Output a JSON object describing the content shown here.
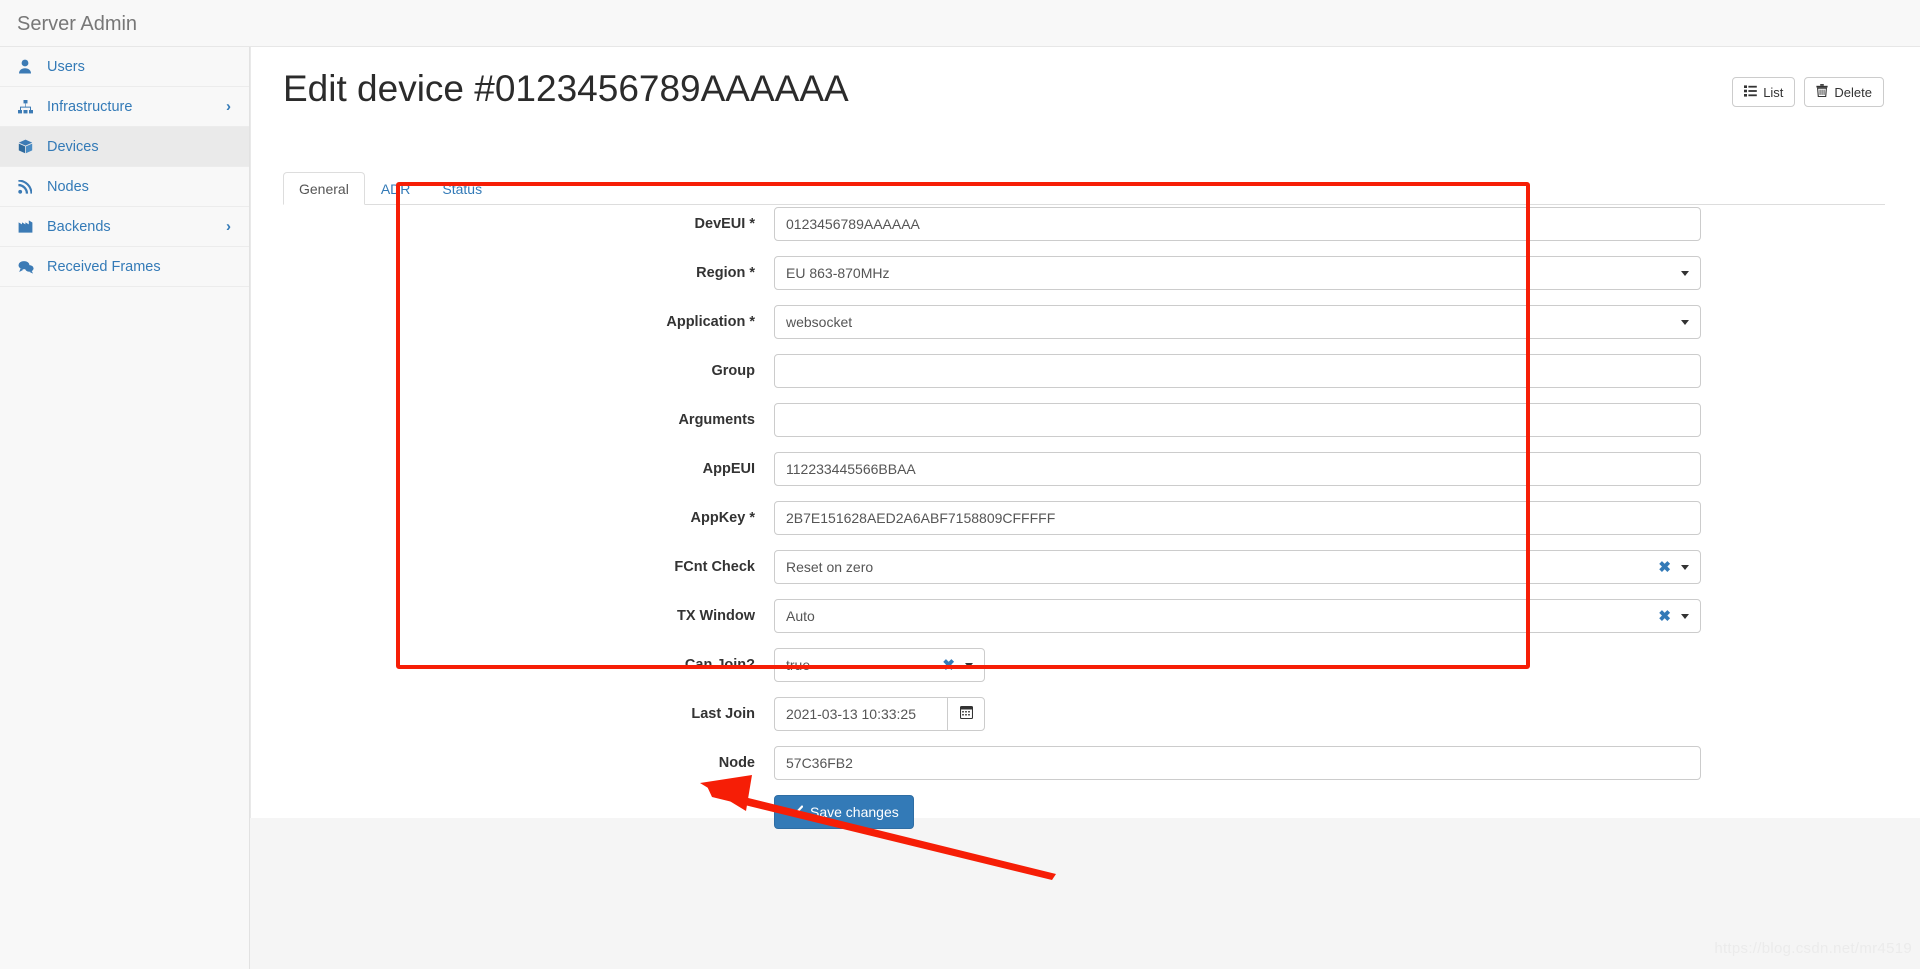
{
  "app": {
    "brand": "Server Admin"
  },
  "sidebar": {
    "items": [
      {
        "label": "Users",
        "icon": "user-icon",
        "has_caret": false,
        "active": false
      },
      {
        "label": "Infrastructure",
        "icon": "sitemap-icon",
        "has_caret": true,
        "active": false
      },
      {
        "label": "Devices",
        "icon": "cube-icon",
        "has_caret": false,
        "active": true
      },
      {
        "label": "Nodes",
        "icon": "rss-icon",
        "has_caret": false,
        "active": false
      },
      {
        "label": "Backends",
        "icon": "bar-chart-icon",
        "has_caret": true,
        "active": false
      },
      {
        "label": "Received Frames",
        "icon": "comments-icon",
        "has_caret": false,
        "active": false
      }
    ],
    "caret_glyph": "›"
  },
  "header": {
    "title": "Edit device #0123456789AAAAAA",
    "actions": [
      {
        "label": "List",
        "icon": "list-icon"
      },
      {
        "label": "Delete",
        "icon": "trash-icon"
      }
    ]
  },
  "tabs": [
    {
      "label": "General",
      "active": true
    },
    {
      "label": "ADR",
      "active": false
    },
    {
      "label": "Status",
      "active": false
    }
  ],
  "form": {
    "fields": [
      {
        "label": "DevEUI",
        "required": true,
        "type": "text",
        "value": "0123456789AAAAAA",
        "placeholder": ""
      },
      {
        "label": "Region",
        "required": true,
        "type": "select",
        "value": "EU 863-870MHz",
        "clearable": false,
        "narrow": false
      },
      {
        "label": "Application",
        "required": true,
        "type": "select",
        "value": "websocket",
        "clearable": false,
        "narrow": false
      },
      {
        "label": "Group",
        "required": false,
        "type": "text",
        "value": "",
        "placeholder": ""
      },
      {
        "label": "Arguments",
        "required": false,
        "type": "text",
        "value": "",
        "placeholder": ""
      },
      {
        "label": "AppEUI",
        "required": false,
        "type": "text",
        "value": "112233445566BBAA",
        "placeholder": ""
      },
      {
        "label": "AppKey",
        "required": true,
        "type": "text",
        "value": "2B7E151628AED2A6ABF7158809CFFFFF",
        "placeholder": ""
      },
      {
        "label": "FCnt Check",
        "required": false,
        "type": "select",
        "value": "Reset on zero",
        "clearable": true,
        "narrow": false
      },
      {
        "label": "TX Window",
        "required": false,
        "type": "select",
        "value": "Auto",
        "clearable": true,
        "narrow": false
      },
      {
        "label": "Can Join?",
        "required": false,
        "type": "select",
        "value": "true",
        "clearable": true,
        "narrow": true
      },
      {
        "label": "Last Join",
        "required": false,
        "type": "datetime",
        "value": "2021-03-13 10:33:25",
        "placeholder": ""
      },
      {
        "label": "Node",
        "required": false,
        "type": "text",
        "value": "57C36FB2",
        "placeholder": ""
      }
    ],
    "required_marker": "*",
    "clear_glyph": "✖",
    "save_label": "Save changes",
    "save_icon": "check-icon"
  },
  "annotations": {
    "box_color": "#f61e06",
    "arrow_color": "#f61e06"
  },
  "watermark": "https://blog.csdn.net/mr4519"
}
